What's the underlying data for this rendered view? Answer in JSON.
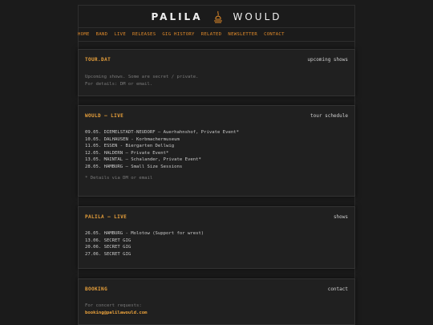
{
  "header": {
    "brand_left": "PALILA",
    "brand_right": "WOULD",
    "logo_icon": "lamp-icon"
  },
  "nav": {
    "items": [
      "HOME",
      "BAND",
      "LIVE",
      "RELEASES",
      "GIG HISTORY",
      "RELATED",
      "NEWSLETTER",
      "CONTACT"
    ]
  },
  "cards": {
    "tour": {
      "title": "TOUR.DAT",
      "tag": "upcoming shows",
      "lines": [
        "Upcoming shows. Some are secret / private.",
        "For details: DM or email."
      ]
    },
    "would_live": {
      "title": "WOULD — LIVE",
      "tag": "tour schedule",
      "lines": [
        "09.05. DIEMELSTADT-NEUDORF — Auerhahnshof, Private Event*",
        "10.05. DALHAUSEN - Korbmachermuseum",
        "11.05. ESSEN - Biergarten Dellwig",
        "12.05. HALDERN — Private Event*",
        "13.05. MAINTAL — Schalander, Private Event*",
        "28.05. HAMBURG — Small Size Sessions"
      ],
      "note": "* Details via DM or email"
    },
    "palila_live": {
      "title": "PALILA — LIVE",
      "tag": "shows",
      "lines": [
        "26.05. HAMBURG - Molotow (Support for wrest)",
        "13.06. SECRET GIG",
        "20.06. SECRET GIG",
        "27.06. SECRET GIG"
      ]
    },
    "booking": {
      "title": "BOOKING",
      "tag": "contact",
      "line": "For concert requests:",
      "email": "booking@palilawould.com"
    }
  },
  "colors": {
    "background": "#1b1b1b",
    "accent": "#e9a13b",
    "nav_link": "#e08a2a",
    "text": "#c9c9c9",
    "muted": "#7a7a7a"
  }
}
